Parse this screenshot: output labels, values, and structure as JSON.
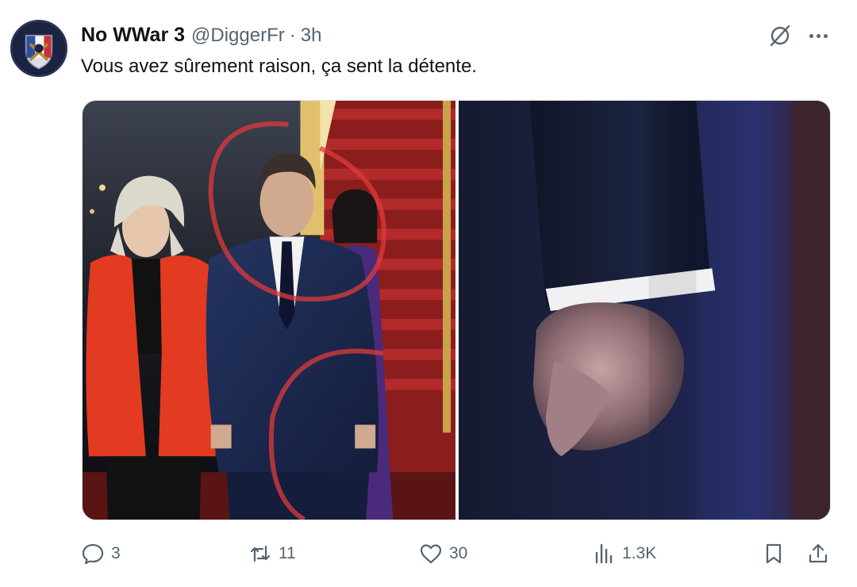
{
  "tweet": {
    "author": {
      "display_name": "No WWar 3",
      "handle": "@DiggerFr",
      "separator": "·",
      "time": "3h",
      "avatar_icon": "shield-avatar-icon"
    },
    "text": "Vous avez sûrement raison, ça sent la détente.",
    "media": [
      {
        "name": "photo-left",
        "kind": "photo"
      },
      {
        "name": "photo-right",
        "kind": "photo"
      }
    ],
    "header_actions": {
      "grok_icon": "grok-icon",
      "more_icon": "more-icon"
    },
    "stats": {
      "replies": "3",
      "reposts": "11",
      "likes": "30",
      "views": "1.3K"
    },
    "action_icons": [
      "reply-icon",
      "repost-icon",
      "like-icon",
      "views-icon",
      "bookmark-icon",
      "share-icon"
    ]
  },
  "colors": {
    "text": "#0f1419",
    "secondary": "#536471",
    "background": "#ffffff"
  }
}
